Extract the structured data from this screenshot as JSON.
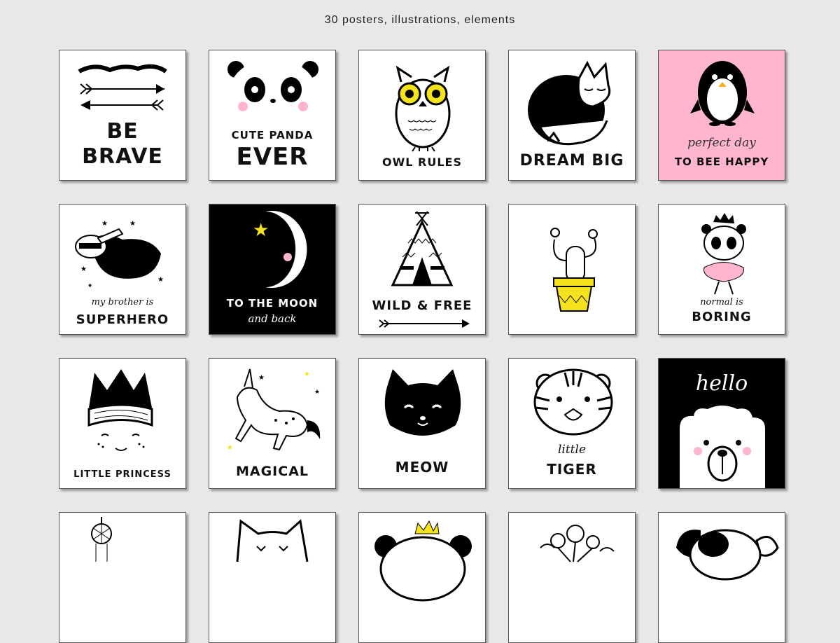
{
  "header": {
    "title": "30 posters, illustrations, elements"
  },
  "cards": [
    {
      "name": "be-brave",
      "lines": [
        "BE",
        "BRAVE"
      ]
    },
    {
      "name": "cute-panda",
      "lines": [
        "CUTE PANDA",
        "EVER"
      ]
    },
    {
      "name": "owl-rules",
      "lines": [
        "OWL RULES"
      ]
    },
    {
      "name": "dream-big",
      "lines": [
        "DREAM BIG"
      ]
    },
    {
      "name": "bee-happy",
      "lines": [
        "perfect day",
        "TO BEE HAPPY"
      ]
    },
    {
      "name": "superhero",
      "lines": [
        "my brother is",
        "SUPERHERO"
      ]
    },
    {
      "name": "moon",
      "lines": [
        "TO THE MOON",
        "and back"
      ]
    },
    {
      "name": "wild-free",
      "lines": [
        "WILD & FREE"
      ]
    },
    {
      "name": "cactus",
      "lines": []
    },
    {
      "name": "boring",
      "lines": [
        "normal is",
        "BORING"
      ]
    },
    {
      "name": "princess",
      "lines": [
        "LITTLE PRINCESS"
      ]
    },
    {
      "name": "magical",
      "lines": [
        "MAGICAL"
      ]
    },
    {
      "name": "meow",
      "lines": [
        "MEOW"
      ]
    },
    {
      "name": "tiger",
      "lines": [
        "little",
        "TIGER"
      ]
    },
    {
      "name": "hello",
      "lines": [
        "hello"
      ]
    }
  ],
  "colors": {
    "accent_pink": "#ffb6cc",
    "accent_yellow": "#f4e21c",
    "dark": "#000000"
  }
}
